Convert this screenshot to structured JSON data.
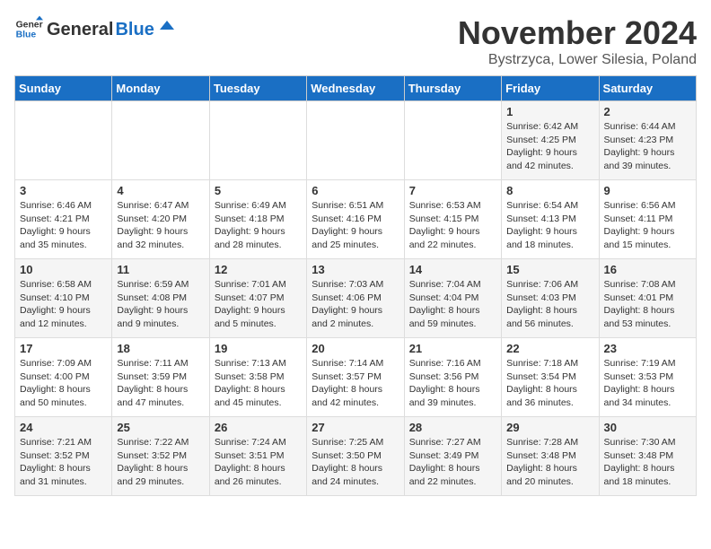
{
  "logo": {
    "general": "General",
    "blue": "Blue"
  },
  "title": "November 2024",
  "location": "Bystrzyca, Lower Silesia, Poland",
  "weekdays": [
    "Sunday",
    "Monday",
    "Tuesday",
    "Wednesday",
    "Thursday",
    "Friday",
    "Saturday"
  ],
  "weeks": [
    [
      {
        "day": "",
        "info": ""
      },
      {
        "day": "",
        "info": ""
      },
      {
        "day": "",
        "info": ""
      },
      {
        "day": "",
        "info": ""
      },
      {
        "day": "",
        "info": ""
      },
      {
        "day": "1",
        "info": "Sunrise: 6:42 AM\nSunset: 4:25 PM\nDaylight: 9 hours\nand 42 minutes."
      },
      {
        "day": "2",
        "info": "Sunrise: 6:44 AM\nSunset: 4:23 PM\nDaylight: 9 hours\nand 39 minutes."
      }
    ],
    [
      {
        "day": "3",
        "info": "Sunrise: 6:46 AM\nSunset: 4:21 PM\nDaylight: 9 hours\nand 35 minutes."
      },
      {
        "day": "4",
        "info": "Sunrise: 6:47 AM\nSunset: 4:20 PM\nDaylight: 9 hours\nand 32 minutes."
      },
      {
        "day": "5",
        "info": "Sunrise: 6:49 AM\nSunset: 4:18 PM\nDaylight: 9 hours\nand 28 minutes."
      },
      {
        "day": "6",
        "info": "Sunrise: 6:51 AM\nSunset: 4:16 PM\nDaylight: 9 hours\nand 25 minutes."
      },
      {
        "day": "7",
        "info": "Sunrise: 6:53 AM\nSunset: 4:15 PM\nDaylight: 9 hours\nand 22 minutes."
      },
      {
        "day": "8",
        "info": "Sunrise: 6:54 AM\nSunset: 4:13 PM\nDaylight: 9 hours\nand 18 minutes."
      },
      {
        "day": "9",
        "info": "Sunrise: 6:56 AM\nSunset: 4:11 PM\nDaylight: 9 hours\nand 15 minutes."
      }
    ],
    [
      {
        "day": "10",
        "info": "Sunrise: 6:58 AM\nSunset: 4:10 PM\nDaylight: 9 hours\nand 12 minutes."
      },
      {
        "day": "11",
        "info": "Sunrise: 6:59 AM\nSunset: 4:08 PM\nDaylight: 9 hours\nand 9 minutes."
      },
      {
        "day": "12",
        "info": "Sunrise: 7:01 AM\nSunset: 4:07 PM\nDaylight: 9 hours\nand 5 minutes."
      },
      {
        "day": "13",
        "info": "Sunrise: 7:03 AM\nSunset: 4:06 PM\nDaylight: 9 hours\nand 2 minutes."
      },
      {
        "day": "14",
        "info": "Sunrise: 7:04 AM\nSunset: 4:04 PM\nDaylight: 8 hours\nand 59 minutes."
      },
      {
        "day": "15",
        "info": "Sunrise: 7:06 AM\nSunset: 4:03 PM\nDaylight: 8 hours\nand 56 minutes."
      },
      {
        "day": "16",
        "info": "Sunrise: 7:08 AM\nSunset: 4:01 PM\nDaylight: 8 hours\nand 53 minutes."
      }
    ],
    [
      {
        "day": "17",
        "info": "Sunrise: 7:09 AM\nSunset: 4:00 PM\nDaylight: 8 hours\nand 50 minutes."
      },
      {
        "day": "18",
        "info": "Sunrise: 7:11 AM\nSunset: 3:59 PM\nDaylight: 8 hours\nand 47 minutes."
      },
      {
        "day": "19",
        "info": "Sunrise: 7:13 AM\nSunset: 3:58 PM\nDaylight: 8 hours\nand 45 minutes."
      },
      {
        "day": "20",
        "info": "Sunrise: 7:14 AM\nSunset: 3:57 PM\nDaylight: 8 hours\nand 42 minutes."
      },
      {
        "day": "21",
        "info": "Sunrise: 7:16 AM\nSunset: 3:56 PM\nDaylight: 8 hours\nand 39 minutes."
      },
      {
        "day": "22",
        "info": "Sunrise: 7:18 AM\nSunset: 3:54 PM\nDaylight: 8 hours\nand 36 minutes."
      },
      {
        "day": "23",
        "info": "Sunrise: 7:19 AM\nSunset: 3:53 PM\nDaylight: 8 hours\nand 34 minutes."
      }
    ],
    [
      {
        "day": "24",
        "info": "Sunrise: 7:21 AM\nSunset: 3:52 PM\nDaylight: 8 hours\nand 31 minutes."
      },
      {
        "day": "25",
        "info": "Sunrise: 7:22 AM\nSunset: 3:52 PM\nDaylight: 8 hours\nand 29 minutes."
      },
      {
        "day": "26",
        "info": "Sunrise: 7:24 AM\nSunset: 3:51 PM\nDaylight: 8 hours\nand 26 minutes."
      },
      {
        "day": "27",
        "info": "Sunrise: 7:25 AM\nSunset: 3:50 PM\nDaylight: 8 hours\nand 24 minutes."
      },
      {
        "day": "28",
        "info": "Sunrise: 7:27 AM\nSunset: 3:49 PM\nDaylight: 8 hours\nand 22 minutes."
      },
      {
        "day": "29",
        "info": "Sunrise: 7:28 AM\nSunset: 3:48 PM\nDaylight: 8 hours\nand 20 minutes."
      },
      {
        "day": "30",
        "info": "Sunrise: 7:30 AM\nSunset: 3:48 PM\nDaylight: 8 hours\nand 18 minutes."
      }
    ]
  ]
}
